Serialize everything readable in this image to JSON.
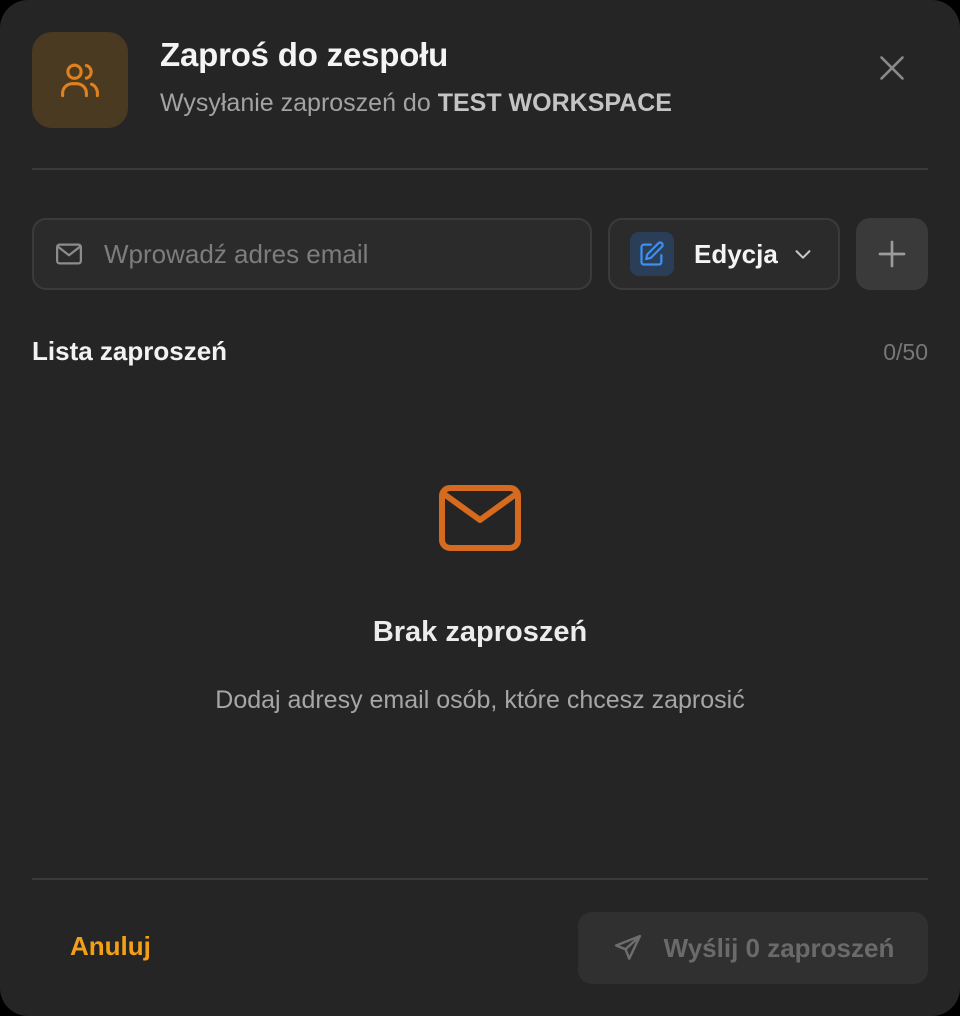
{
  "colors": {
    "modal_bg": "#252525",
    "accent_orange": "#f4a017",
    "icon_orange": "#e0801e",
    "edit_blue": "#3d8ff0",
    "disabled_text": "#6a6a6a"
  },
  "header": {
    "icon": "users-icon",
    "title": "Zaproś do zespołu",
    "subtitle_prefix": "Wysyłanie zaproszeń do",
    "workspace_name": "TEST WORKSPACE",
    "close_icon": "close-icon"
  },
  "invite_form": {
    "email_icon": "mail-icon",
    "email_placeholder": "Wprowadź adres email",
    "email_value": "",
    "role_icon": "edit-icon",
    "role_selected": "Edycja",
    "role_chevron_icon": "chevron-down-icon",
    "add_icon": "plus-icon"
  },
  "list": {
    "title": "Lista zaproszeń",
    "count": "0/50"
  },
  "empty_state": {
    "icon": "mail-icon",
    "title": "Brak zaproszeń",
    "description": "Dodaj adresy email osób, które chcesz zaprosić"
  },
  "footer": {
    "cancel_label": "Anuluj",
    "send_icon": "send-icon",
    "send_label": "Wyślij 0 zaproszeń"
  }
}
